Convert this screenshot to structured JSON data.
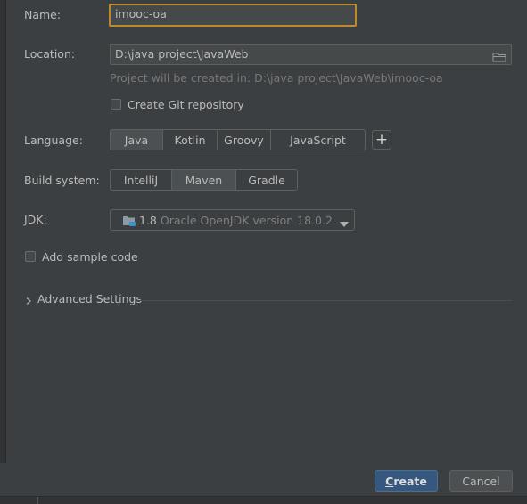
{
  "form": {
    "name_label": "Name:",
    "name_value": "imooc-oa",
    "location_label": "Location:",
    "location_value": "D:\\java project\\JavaWeb",
    "location_hint": "Project will be created in: D:\\java project\\JavaWeb\\imooc-oa",
    "git_label": "Create Git repository",
    "git_checked": false,
    "language_label": "Language:",
    "languages": [
      "Java",
      "Kotlin",
      "Groovy",
      "JavaScript"
    ],
    "language_selected": "Java",
    "add_language": "+",
    "build_label": "Build system:",
    "build_systems": [
      "IntelliJ",
      "Maven",
      "Gradle"
    ],
    "build_selected": "Maven",
    "jdk_label": "JDK:",
    "jdk_version": "1.8",
    "jdk_desc": "Oracle OpenJDK version 18.0.2",
    "sample_label": "Add sample code",
    "sample_checked": false,
    "advanced_label": "Advanced Settings"
  },
  "buttons": {
    "create_first": "C",
    "create_rest": "reate",
    "cancel": "Cancel"
  },
  "icons": {
    "folder": "folder-icon",
    "jdk": "jdk-folder-icon",
    "dropdown": "dropdown-arrow-icon",
    "chevron": "chevron-right-icon"
  }
}
